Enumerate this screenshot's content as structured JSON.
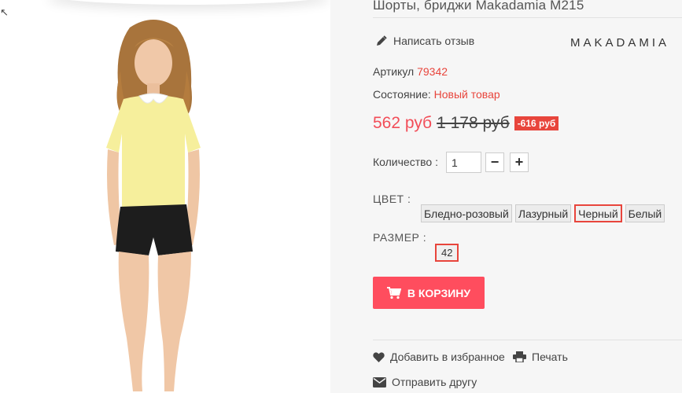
{
  "product": {
    "title": "Шорты, бриджи Makadamia M215",
    "brand": "MAKADAMIA",
    "review_link": "Написать отзыв",
    "sku_label": "Артикул",
    "sku_value": "79342",
    "condition_label": "Состояние:",
    "condition_value": "Новый товар",
    "price_new": "562 руб",
    "price_old": "1 178 руб",
    "discount": "-616 руб"
  },
  "quantity": {
    "label": "Количество :",
    "value": "1",
    "minus": "−",
    "plus": "+"
  },
  "options": {
    "color_label": "ЦВЕТ :",
    "colors": [
      "Бледно-розовый",
      "Лазурный",
      "Черный",
      "Белый"
    ],
    "selected_color": "Черный",
    "size_label": "РАЗМЕР :",
    "sizes": [
      "42"
    ]
  },
  "cart_button": "В КОРЗИНУ",
  "actions": {
    "favorite": "Добавить в избранное",
    "print": "Печать",
    "send": "Отправить другу"
  },
  "colors": {
    "accent": "#e8453c",
    "price": "#f24d58",
    "cart": "#ff4d5e",
    "panel": "#f6f6f6"
  },
  "icons": [
    "pencil-icon",
    "cart-icon",
    "heart-icon",
    "printer-icon",
    "envelope-icon"
  ]
}
